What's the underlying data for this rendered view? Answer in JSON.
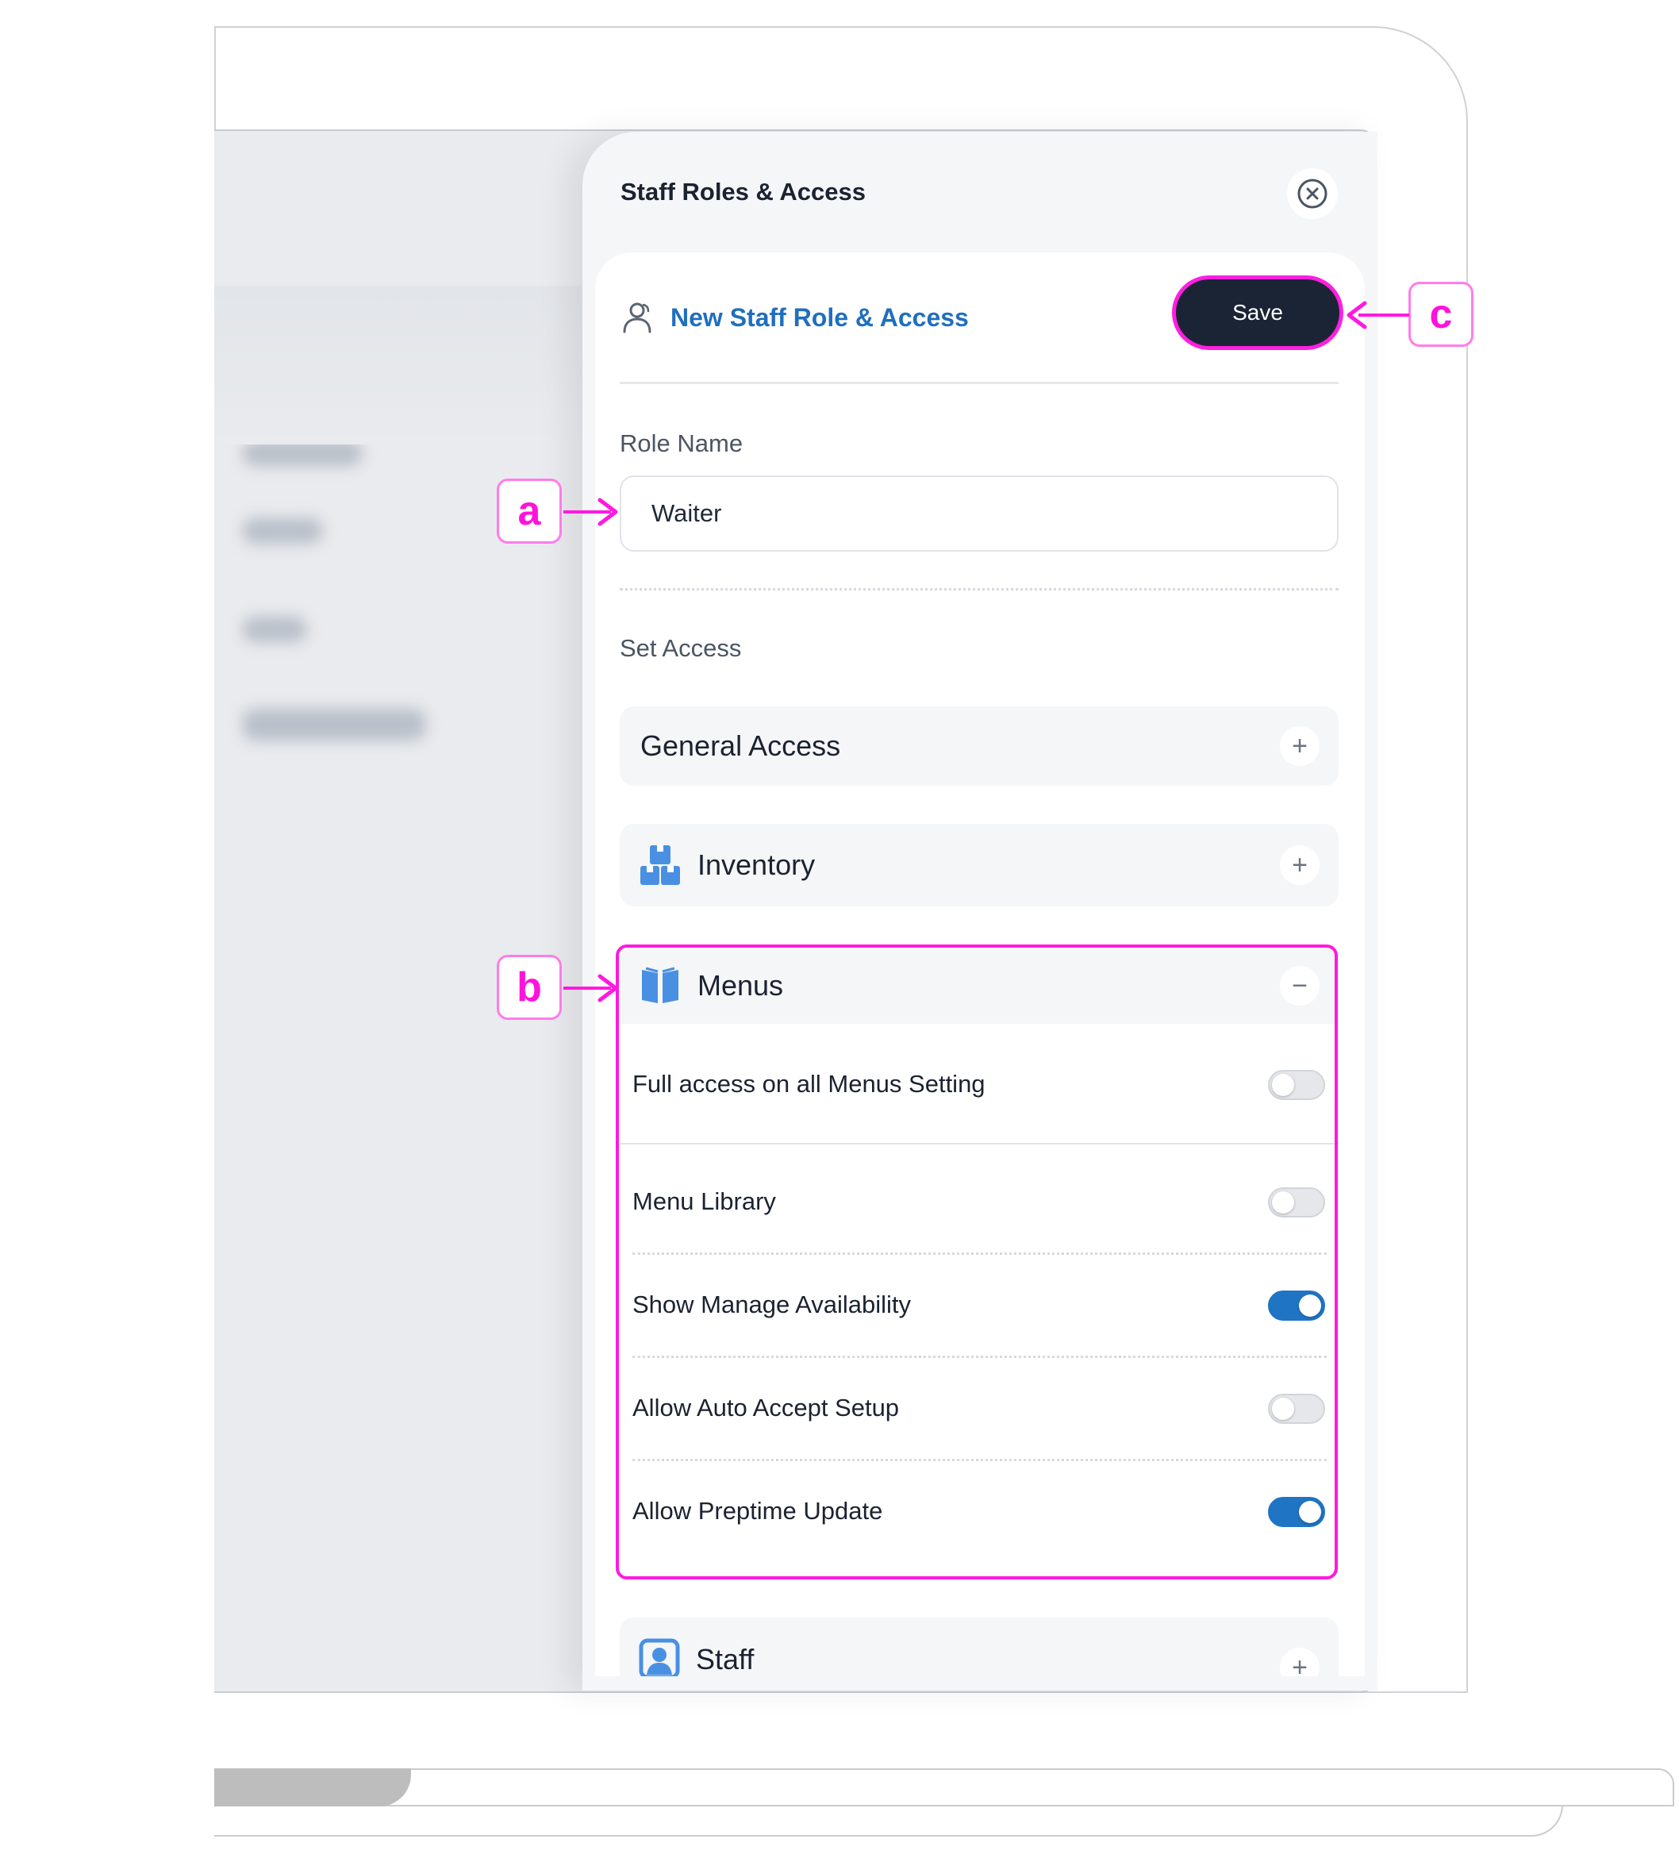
{
  "panel": {
    "title": "Staff Roles & Access",
    "header_title": "New Staff Role & Access",
    "save_label": "Save"
  },
  "form": {
    "role_name_label": "Role Name",
    "role_name_value": "Waiter",
    "set_access_label": "Set Access"
  },
  "sections": {
    "general": "General Access",
    "inventory": "Inventory",
    "menus": "Menus",
    "staff": "Staff"
  },
  "menus_items": [
    {
      "label": "Full access on all Menus Setting",
      "on": false
    },
    {
      "label": "Menu Library",
      "on": false
    },
    {
      "label": "Show Manage Availability",
      "on": true
    },
    {
      "label": "Allow Auto Accept Setup",
      "on": false
    },
    {
      "label": "Allow Preptime Update",
      "on": true
    }
  ],
  "markers": {
    "a": "a",
    "b": "b",
    "c": "c"
  },
  "colors": {
    "accent": "#1f74c4",
    "highlight": "#ff19e0",
    "save_bg": "#1b2435"
  },
  "icons": [
    "close-icon",
    "user-icon",
    "boxes-icon",
    "book-icon",
    "person-badge-icon",
    "plus-icon",
    "minus-icon"
  ]
}
